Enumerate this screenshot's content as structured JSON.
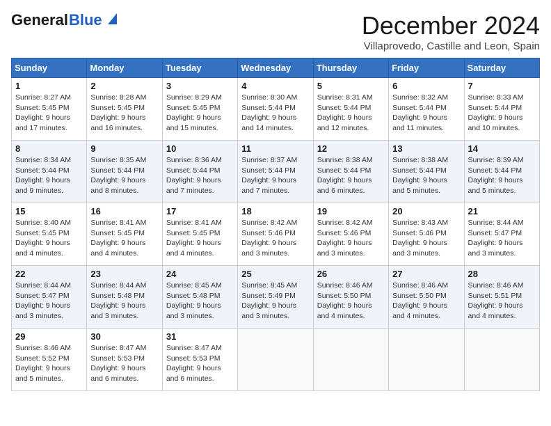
{
  "header": {
    "logo_general": "General",
    "logo_blue": "Blue",
    "month_title": "December 2024",
    "subtitle": "Villaprovedo, Castille and Leon, Spain"
  },
  "days_of_week": [
    "Sunday",
    "Monday",
    "Tuesday",
    "Wednesday",
    "Thursday",
    "Friday",
    "Saturday"
  ],
  "weeks": [
    [
      {
        "day": "1",
        "sunrise": "8:27 AM",
        "sunset": "5:45 PM",
        "daylight": "9 hours and 17 minutes."
      },
      {
        "day": "2",
        "sunrise": "8:28 AM",
        "sunset": "5:45 PM",
        "daylight": "9 hours and 16 minutes."
      },
      {
        "day": "3",
        "sunrise": "8:29 AM",
        "sunset": "5:45 PM",
        "daylight": "9 hours and 15 minutes."
      },
      {
        "day": "4",
        "sunrise": "8:30 AM",
        "sunset": "5:44 PM",
        "daylight": "9 hours and 14 minutes."
      },
      {
        "day": "5",
        "sunrise": "8:31 AM",
        "sunset": "5:44 PM",
        "daylight": "9 hours and 12 minutes."
      },
      {
        "day": "6",
        "sunrise": "8:32 AM",
        "sunset": "5:44 PM",
        "daylight": "9 hours and 11 minutes."
      },
      {
        "day": "7",
        "sunrise": "8:33 AM",
        "sunset": "5:44 PM",
        "daylight": "9 hours and 10 minutes."
      }
    ],
    [
      {
        "day": "8",
        "sunrise": "8:34 AM",
        "sunset": "5:44 PM",
        "daylight": "9 hours and 9 minutes."
      },
      {
        "day": "9",
        "sunrise": "8:35 AM",
        "sunset": "5:44 PM",
        "daylight": "9 hours and 8 minutes."
      },
      {
        "day": "10",
        "sunrise": "8:36 AM",
        "sunset": "5:44 PM",
        "daylight": "9 hours and 7 minutes."
      },
      {
        "day": "11",
        "sunrise": "8:37 AM",
        "sunset": "5:44 PM",
        "daylight": "9 hours and 7 minutes."
      },
      {
        "day": "12",
        "sunrise": "8:38 AM",
        "sunset": "5:44 PM",
        "daylight": "9 hours and 6 minutes."
      },
      {
        "day": "13",
        "sunrise": "8:38 AM",
        "sunset": "5:44 PM",
        "daylight": "9 hours and 5 minutes."
      },
      {
        "day": "14",
        "sunrise": "8:39 AM",
        "sunset": "5:44 PM",
        "daylight": "9 hours and 5 minutes."
      }
    ],
    [
      {
        "day": "15",
        "sunrise": "8:40 AM",
        "sunset": "5:45 PM",
        "daylight": "9 hours and 4 minutes."
      },
      {
        "day": "16",
        "sunrise": "8:41 AM",
        "sunset": "5:45 PM",
        "daylight": "9 hours and 4 minutes."
      },
      {
        "day": "17",
        "sunrise": "8:41 AM",
        "sunset": "5:45 PM",
        "daylight": "9 hours and 4 minutes."
      },
      {
        "day": "18",
        "sunrise": "8:42 AM",
        "sunset": "5:46 PM",
        "daylight": "9 hours and 3 minutes."
      },
      {
        "day": "19",
        "sunrise": "8:42 AM",
        "sunset": "5:46 PM",
        "daylight": "9 hours and 3 minutes."
      },
      {
        "day": "20",
        "sunrise": "8:43 AM",
        "sunset": "5:46 PM",
        "daylight": "9 hours and 3 minutes."
      },
      {
        "day": "21",
        "sunrise": "8:44 AM",
        "sunset": "5:47 PM",
        "daylight": "9 hours and 3 minutes."
      }
    ],
    [
      {
        "day": "22",
        "sunrise": "8:44 AM",
        "sunset": "5:47 PM",
        "daylight": "9 hours and 3 minutes."
      },
      {
        "day": "23",
        "sunrise": "8:44 AM",
        "sunset": "5:48 PM",
        "daylight": "9 hours and 3 minutes."
      },
      {
        "day": "24",
        "sunrise": "8:45 AM",
        "sunset": "5:48 PM",
        "daylight": "9 hours and 3 minutes."
      },
      {
        "day": "25",
        "sunrise": "8:45 AM",
        "sunset": "5:49 PM",
        "daylight": "9 hours and 3 minutes."
      },
      {
        "day": "26",
        "sunrise": "8:46 AM",
        "sunset": "5:50 PM",
        "daylight": "9 hours and 4 minutes."
      },
      {
        "day": "27",
        "sunrise": "8:46 AM",
        "sunset": "5:50 PM",
        "daylight": "9 hours and 4 minutes."
      },
      {
        "day": "28",
        "sunrise": "8:46 AM",
        "sunset": "5:51 PM",
        "daylight": "9 hours and 4 minutes."
      }
    ],
    [
      {
        "day": "29",
        "sunrise": "8:46 AM",
        "sunset": "5:52 PM",
        "daylight": "9 hours and 5 minutes."
      },
      {
        "day": "30",
        "sunrise": "8:47 AM",
        "sunset": "5:53 PM",
        "daylight": "9 hours and 6 minutes."
      },
      {
        "day": "31",
        "sunrise": "8:47 AM",
        "sunset": "5:53 PM",
        "daylight": "9 hours and 6 minutes."
      },
      null,
      null,
      null,
      null
    ]
  ],
  "labels": {
    "sunrise": "Sunrise:",
    "sunset": "Sunset:",
    "daylight": "Daylight:"
  }
}
